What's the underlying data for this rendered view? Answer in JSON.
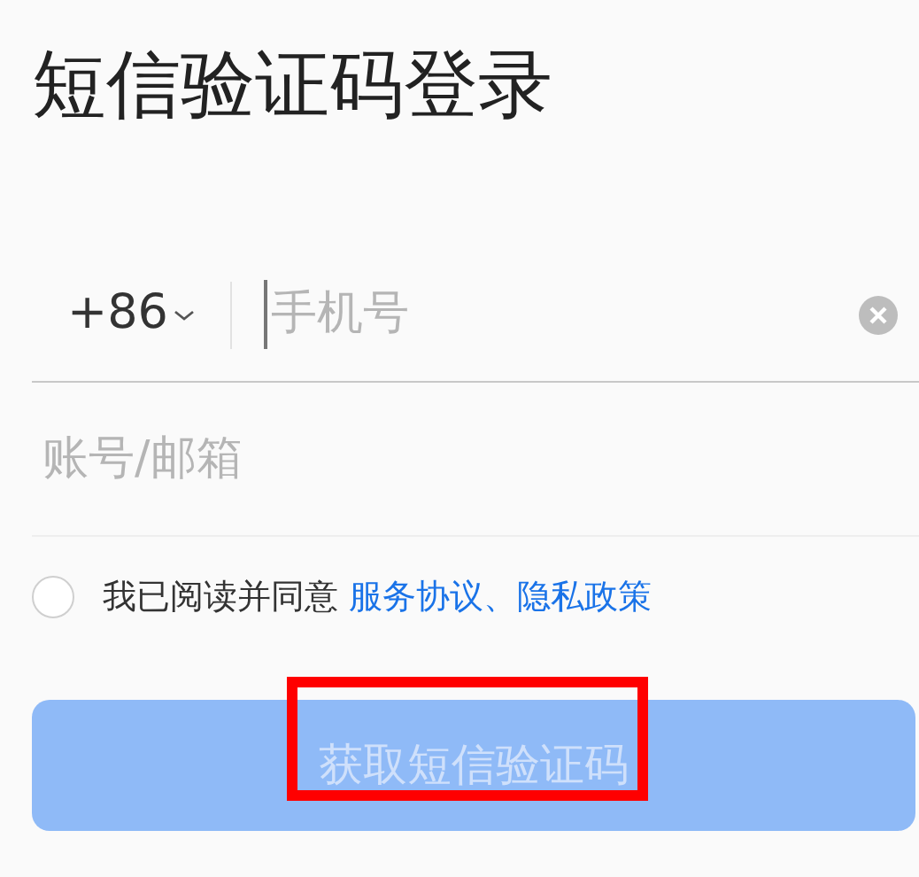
{
  "title": "短信验证码登录",
  "phone": {
    "country_code": "+86",
    "placeholder": "手机号"
  },
  "account": {
    "placeholder": "账号/邮箱"
  },
  "agreement": {
    "checked": false,
    "text": "我已阅读并同意",
    "links": [
      "服务协议",
      "、",
      "隐私政策"
    ]
  },
  "submit": {
    "label": "获取短信验证码",
    "disabled": true
  },
  "annotation": {
    "kind": "highlight"
  }
}
